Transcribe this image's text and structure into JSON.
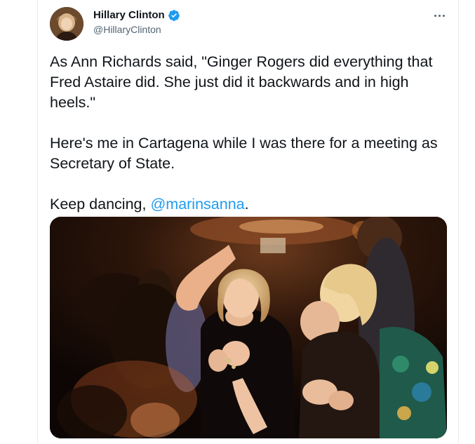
{
  "tweet": {
    "author": {
      "name": "Hillary Clinton",
      "handle": "@HillaryClinton",
      "verified": true,
      "verified_color": "#1d9bf0"
    },
    "text": {
      "line1": "As Ann Richards said, \"Ginger Rogers did everything that Fred Astaire did. She just did it backwards and in high heels.\"",
      "line2": "Here's me in Cartagena while I was there for a meeting as Secretary of State.",
      "line3_prefix": "Keep dancing, ",
      "mention": "@marinsanna",
      "line3_suffix": "."
    },
    "media": {
      "kind": "photo"
    }
  },
  "colors": {
    "text": "#0f1419",
    "secondary": "#536471",
    "link": "#1d9bf0"
  },
  "icons": {
    "verified": "verified-badge-icon",
    "more": "more-options-icon"
  }
}
